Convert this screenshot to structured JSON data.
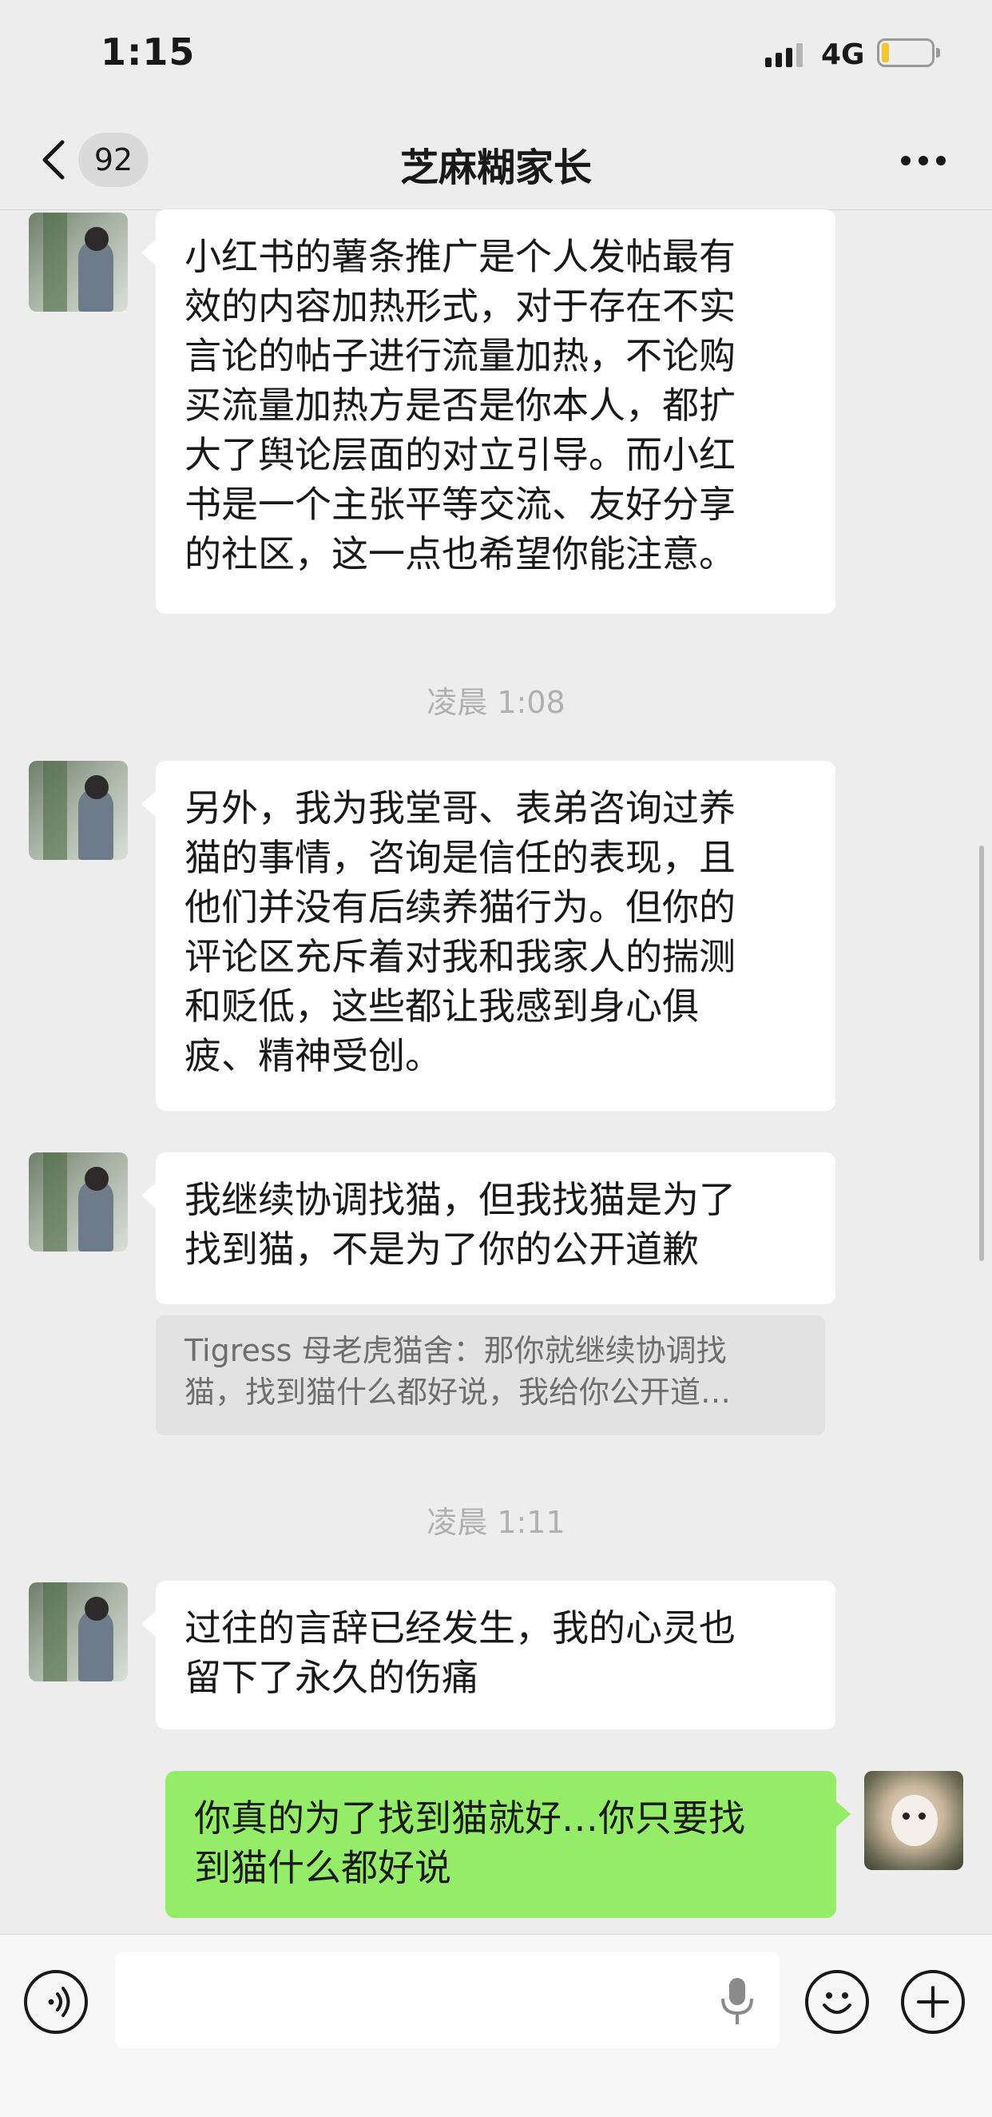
{
  "status_bar": {
    "time": "1:15",
    "network": "4G"
  },
  "nav": {
    "unread_count": "92",
    "title": "芝麻糊家长"
  },
  "messages": [
    {
      "lines": [
        "小红书的薯条推广是个人发帖最有",
        "效的内容加热形式，对于存在不实",
        "言论的帖子进行流量加热，不论购",
        "买流量加热方是否是你本人，都扩",
        "大了舆论层面的对立引导。而小红",
        "书是一个主张平等交流、友好分享",
        "的社区，这一点也希望你能注意。"
      ]
    },
    {
      "lines": [
        "另外，我为我堂哥、表弟咨询过养",
        "猫的事情，咨询是信任的表现，且",
        "他们并没有后续养猫行为。但你的",
        "评论区充斥着对我和我家人的揣测",
        "和贬低，这些都让我感到身心俱",
        "疲、精神受创。"
      ]
    },
    {
      "lines": [
        "我继续协调找猫，但我找猫是为了",
        "找到猫，不是为了你的公开道歉"
      ]
    },
    {
      "lines": [
        "过往的言辞已经发生，我的心灵也",
        "留下了永久的伤痛"
      ]
    }
  ],
  "quote": {
    "lines": [
      "Tigress 母老虎猫舍：那你就继续协调找",
      "猫，找到猫什么都好说，我给你公开道…"
    ]
  },
  "timestamps": [
    "凌晨 1:08",
    "凌晨 1:11"
  ],
  "my_message": {
    "lines": [
      "你真的为了找到猫就好…你只要找",
      "到猫什么都好说"
    ]
  },
  "input": {
    "placeholder": ""
  },
  "colors": {
    "background": "#ededed",
    "my_bubble": "#95ec69",
    "their_bubble": "#ffffff",
    "battery_level": "#f2c531"
  },
  "icons": [
    "back-arrow-icon",
    "more-icon",
    "voice-icon",
    "mic-icon",
    "emoji-icon",
    "plus-icon",
    "signal-icon",
    "battery-icon"
  ]
}
